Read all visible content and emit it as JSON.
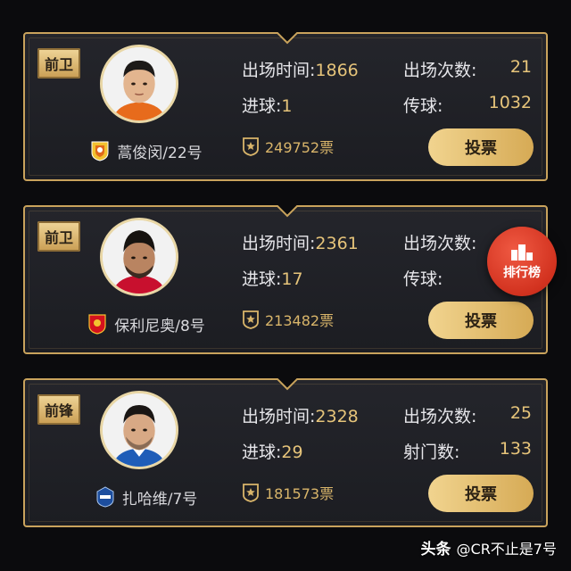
{
  "players": [
    {
      "position": "前卫",
      "name": "蒿俊闵/22号",
      "team_logo": "shandong-luneng-crest-icon",
      "stats": {
        "appearance_time_label": "出场时间:",
        "appearance_time": "1866",
        "goals_label": "进球:",
        "goals": "1",
        "appearances_label": "出场次数:",
        "appearances": "21",
        "extra_label": "传球:",
        "extra_value": "1032"
      },
      "votes": "249752票",
      "vote_button": "投票",
      "accent": "#c9a35c"
    },
    {
      "position": "前卫",
      "name": "保利尼奥/8号",
      "team_logo": "guangzhou-evergrande-crest-icon",
      "stats": {
        "appearance_time_label": "出场时间:",
        "appearance_time": "2361",
        "goals_label": "进球:",
        "goals": "17",
        "appearances_label": "出场次数:",
        "appearances": "",
        "extra_label": "传球:",
        "extra_value": ""
      },
      "votes": "213482票",
      "vote_button": "投票",
      "accent": "#c9a35c"
    },
    {
      "position": "前锋",
      "name": "扎哈维/7号",
      "team_logo": "guangzhou-rf-crest-icon",
      "stats": {
        "appearance_time_label": "出场时间:",
        "appearance_time": "2328",
        "goals_label": "进球:",
        "goals": "29",
        "appearances_label": "出场次数:",
        "appearances": "25",
        "extra_label": "射门数:",
        "extra_value": "133"
      },
      "votes": "181573票",
      "vote_button": "投票",
      "accent": "#c9a35c"
    }
  ],
  "rank_button": {
    "label": "排行榜",
    "icon": "podium-icon",
    "color": "#d9331f"
  },
  "watermark": {
    "brand": "头条",
    "handle": "@CR不止是7号"
  }
}
